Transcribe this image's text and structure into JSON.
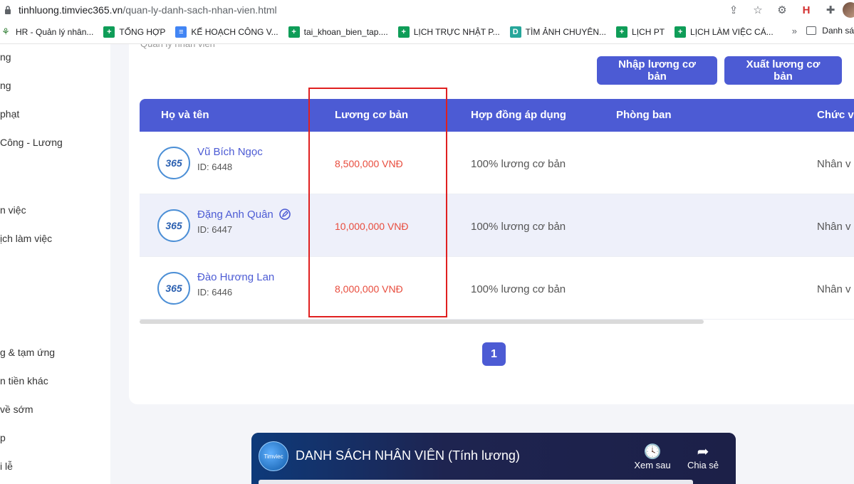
{
  "browser": {
    "url_host": "tinhluong.timviec365.vn",
    "url_path": "/quan-ly-danh-sach-nhan-vien.html",
    "bookmarks": [
      {
        "label": "HR - Quản lý nhân...",
        "icon": "hr-icon"
      },
      {
        "label": "TỔNG HỢP",
        "icon": "sheet-icon"
      },
      {
        "label": "KẾ HOẠCH CÔNG V...",
        "icon": "doc-icon"
      },
      {
        "label": "tai_khoan_bien_tap....",
        "icon": "sheet-icon"
      },
      {
        "label": "LỊCH TRỰC NHẬT P...",
        "icon": "sheet-icon"
      },
      {
        "label": "TÌM ẢNH CHUYÊN...",
        "icon": "d-icon"
      },
      {
        "label": "LỊCH PT",
        "icon": "sheet-icon"
      },
      {
        "label": "LỊCH LÀM VIỆC CÁ...",
        "icon": "sheet-icon"
      }
    ],
    "more_label": "»",
    "reading_list": "Danh sá"
  },
  "sidebar": {
    "items": [
      "ng",
      "ng",
      "phạt",
      "Công - Lương",
      "n việc",
      "ịch làm việc",
      "g & tạm ứng",
      "n tiền khác",
      "về sớm",
      "p",
      "i lễ"
    ]
  },
  "main": {
    "breadcrumb": "Quản lý nhân viên",
    "import_button": "Nhập lương cơ bản",
    "export_button": "Xuất lương cơ bản",
    "columns": [
      "Họ và tên",
      "Lương cơ bản",
      "Hợp đồng áp dụng",
      "Phòng ban",
      "Chức v"
    ],
    "rows": [
      {
        "name": "Vũ Bích Ngọc",
        "id": "ID: 6448",
        "salary": "8,500,000 VNĐ",
        "contract": "100% lương cơ bản",
        "department": "",
        "position": "Nhân v"
      },
      {
        "name": "Đặng Anh Quân",
        "id": "ID: 6447",
        "salary": "10,000,000 VNĐ",
        "contract": "100% lương cơ bản",
        "department": "",
        "position": "Nhân v"
      },
      {
        "name": "Đào Hương Lan",
        "id": "ID: 6446",
        "salary": "8,000,000 VNĐ",
        "contract": "100% lương cơ bản",
        "department": "",
        "position": "Nhân v"
      }
    ],
    "logo_text": "365",
    "page": "1"
  },
  "video": {
    "title": "DANH SÁCH NHÂN VIÊN (Tính lương)",
    "watch_later": "Xem sau",
    "share": "Chia sẻ",
    "channel_text": "Timviec"
  },
  "colors": {
    "accent": "#4c5bd4",
    "salary": "#e84c3d",
    "highlight_box": "#e02020"
  }
}
